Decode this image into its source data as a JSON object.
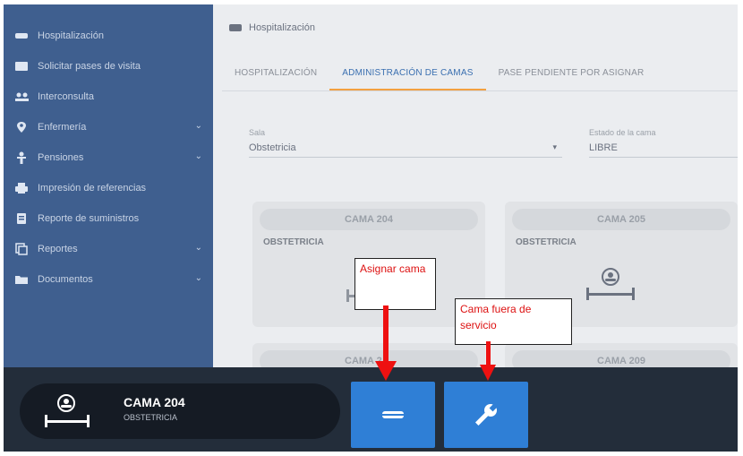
{
  "sidebar": {
    "items": [
      {
        "label": "Hospitalización",
        "icon": "bed-icon",
        "has_caret": false
      },
      {
        "label": "Solicitar pases de visita",
        "icon": "card-icon",
        "has_caret": false
      },
      {
        "label": "Interconsulta",
        "icon": "people-icon",
        "has_caret": false
      },
      {
        "label": "Enfermería",
        "icon": "location-pin-icon",
        "has_caret": true
      },
      {
        "label": "Pensiones",
        "icon": "person-icon",
        "has_caret": true
      },
      {
        "label": "Impresión de referencias",
        "icon": "printer-icon",
        "has_caret": false
      },
      {
        "label": "Reporte de suministros",
        "icon": "document-icon",
        "has_caret": false
      },
      {
        "label": "Reportes",
        "icon": "copy-icon",
        "has_caret": true
      },
      {
        "label": "Documentos",
        "icon": "folder-icon",
        "has_caret": true
      }
    ]
  },
  "header": {
    "title": "Hospitalización"
  },
  "tabs": [
    {
      "label": "HOSPITALIZACIÓN",
      "active": false
    },
    {
      "label": "ADMINISTRACIÓN DE CAMAS",
      "active": true
    },
    {
      "label": "PASE PENDIENTE POR ASIGNAR",
      "active": false
    }
  ],
  "filters": {
    "area": {
      "label": "Sala",
      "value": "Obstetricia"
    },
    "bed_status": {
      "label": "Estado de la cama",
      "value": "LIBRE"
    }
  },
  "cards": [
    {
      "title": "CAMA 204",
      "service": "OBSTETRICIA"
    },
    {
      "title": "CAMA 205",
      "service": "OBSTETRICIA"
    },
    {
      "title": "CAMA 2__",
      "service": ""
    },
    {
      "title": "CAMA 209",
      "service": ""
    }
  ],
  "selected_bed": {
    "title": "CAMA 204",
    "service": "OBSTETRICIA"
  },
  "annotations": {
    "assign": "Asignar cama",
    "out_of_service": "Cama fuera de servicio"
  },
  "colors": {
    "sidebar": "#3f5f8f",
    "bottombar": "#232d3a",
    "action_button": "#2f7fd6",
    "tab_active_underline": "#f3a040",
    "annotation_text": "#dd1111",
    "arrow": "#ee1111"
  }
}
